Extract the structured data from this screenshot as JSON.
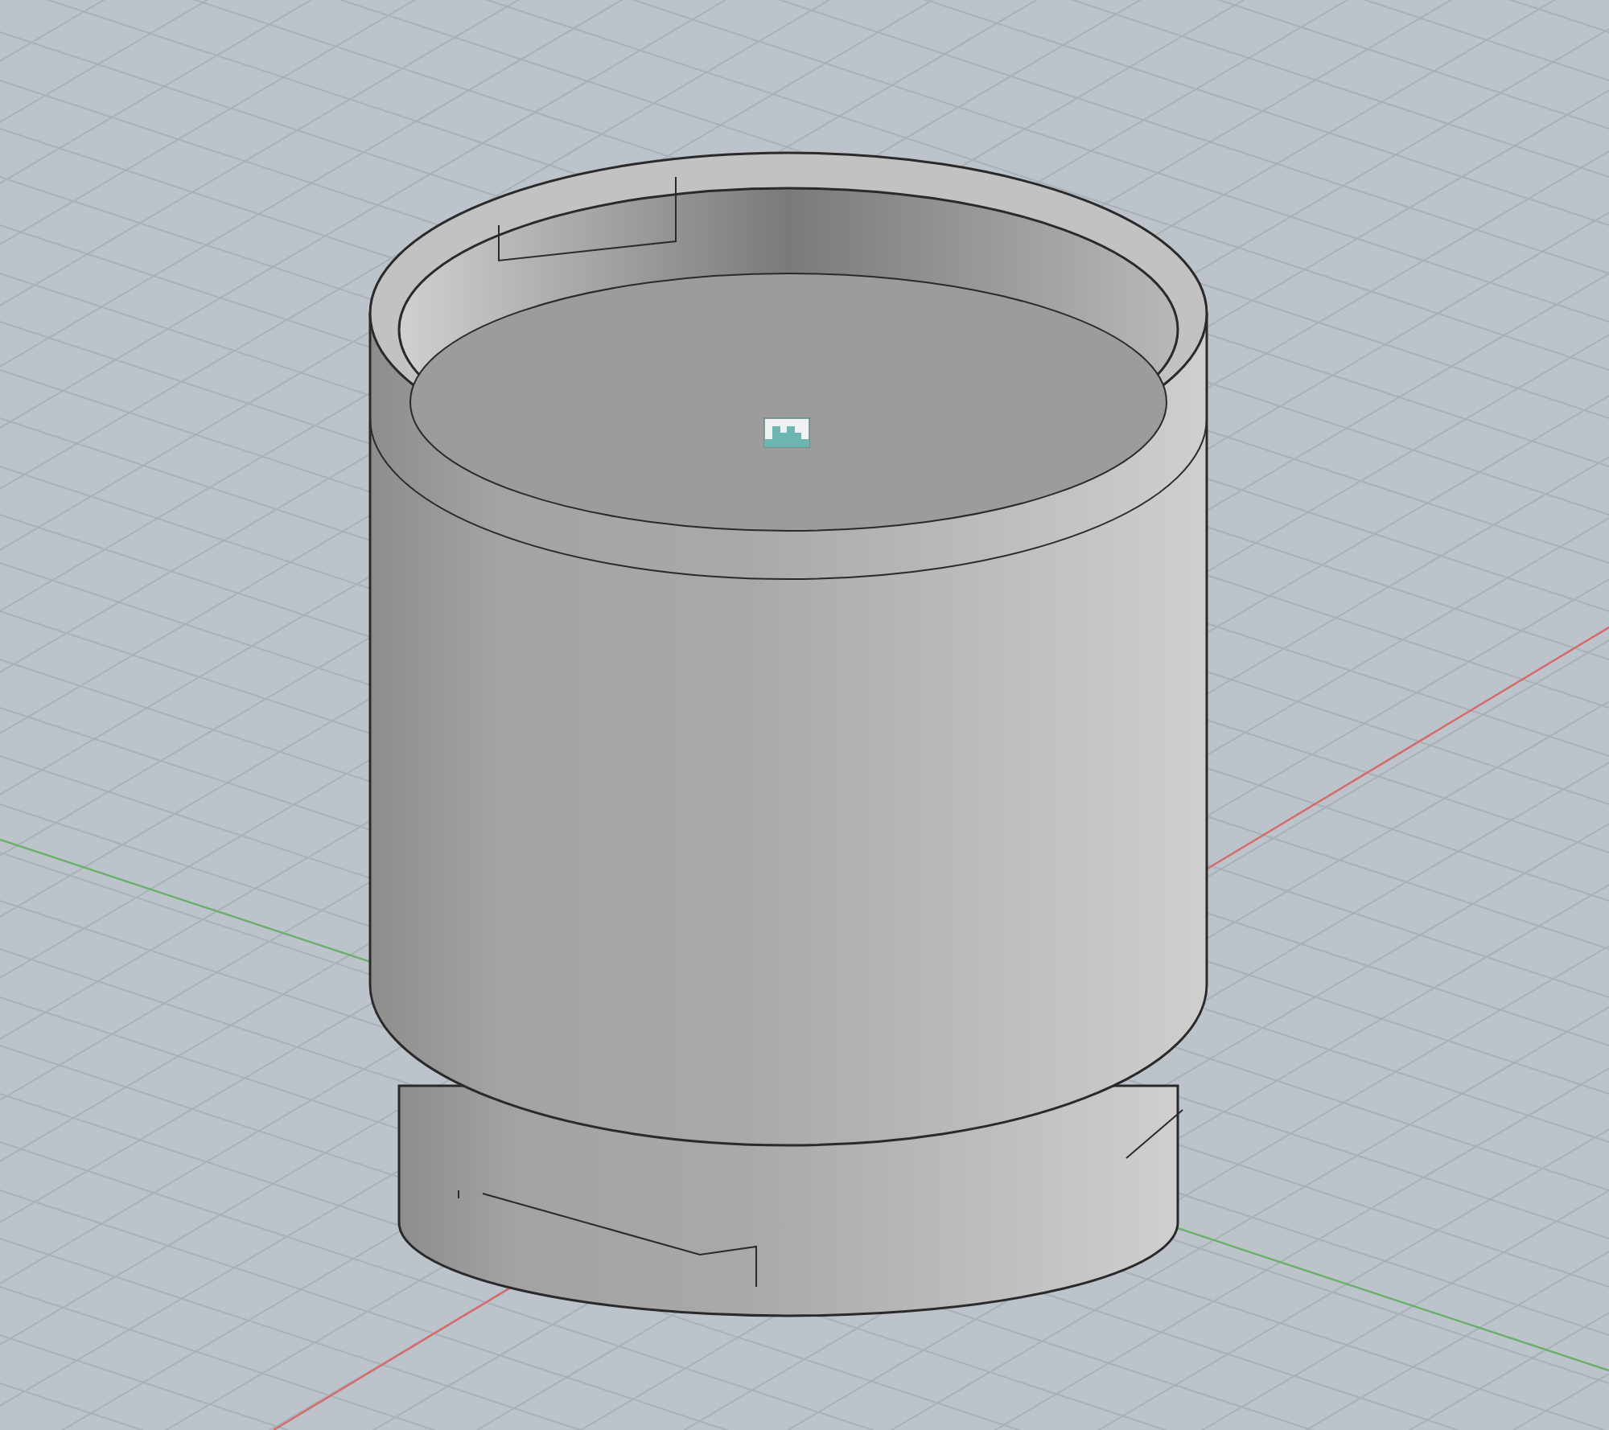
{
  "viewport": {
    "axes": [
      {
        "kind": "x",
        "color": "#d46a6a"
      },
      {
        "kind": "y",
        "color": "#6ab06a"
      }
    ]
  }
}
